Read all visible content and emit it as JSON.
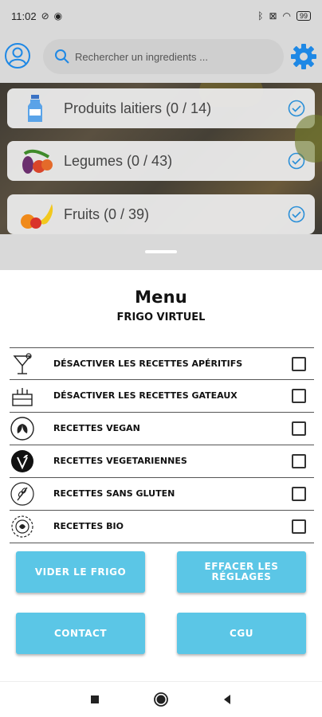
{
  "status_bar": {
    "time": "11:02",
    "battery": "99"
  },
  "search": {
    "placeholder": "Rechercher un ingredients ..."
  },
  "categories": [
    {
      "label": "Produits laitiers (0 / 14)",
      "icon": "milk-bottle-icon"
    },
    {
      "label": "Legumes (0 / 43)",
      "icon": "vegetables-icon"
    },
    {
      "label": "Fruits (0 / 39)",
      "icon": "fruits-icon"
    }
  ],
  "menu": {
    "title": "Menu",
    "subtitle": "FRIGO VIRTUEL",
    "options": [
      {
        "label": "DÉSACTIVER LES RECETTES APÉRITIFS",
        "icon": "cocktail-icon",
        "checked": false
      },
      {
        "label": "DÉSACTIVER LES RECETTES GATEAUX",
        "icon": "cake-icon",
        "checked": false
      },
      {
        "label": "RECETTES VEGAN",
        "icon": "vegan-leaf-icon",
        "checked": false
      },
      {
        "label": "RECETTES VEGETARIENNES",
        "icon": "vegetarian-icon",
        "checked": false
      },
      {
        "label": "RECETTES SANS GLUTEN",
        "icon": "gluten-free-icon",
        "checked": false
      },
      {
        "label": "RECETTES BIO",
        "icon": "bio-label-icon",
        "checked": false
      }
    ],
    "buttons": {
      "empty_fridge": "VIDER LE FRIGO",
      "reset_settings": "EFFACER LES RÉGLAGES",
      "contact": "CONTACT",
      "terms": "CGU"
    }
  },
  "colors": {
    "accent": "#5bc6e6",
    "settings_blue": "#1e88e5"
  }
}
